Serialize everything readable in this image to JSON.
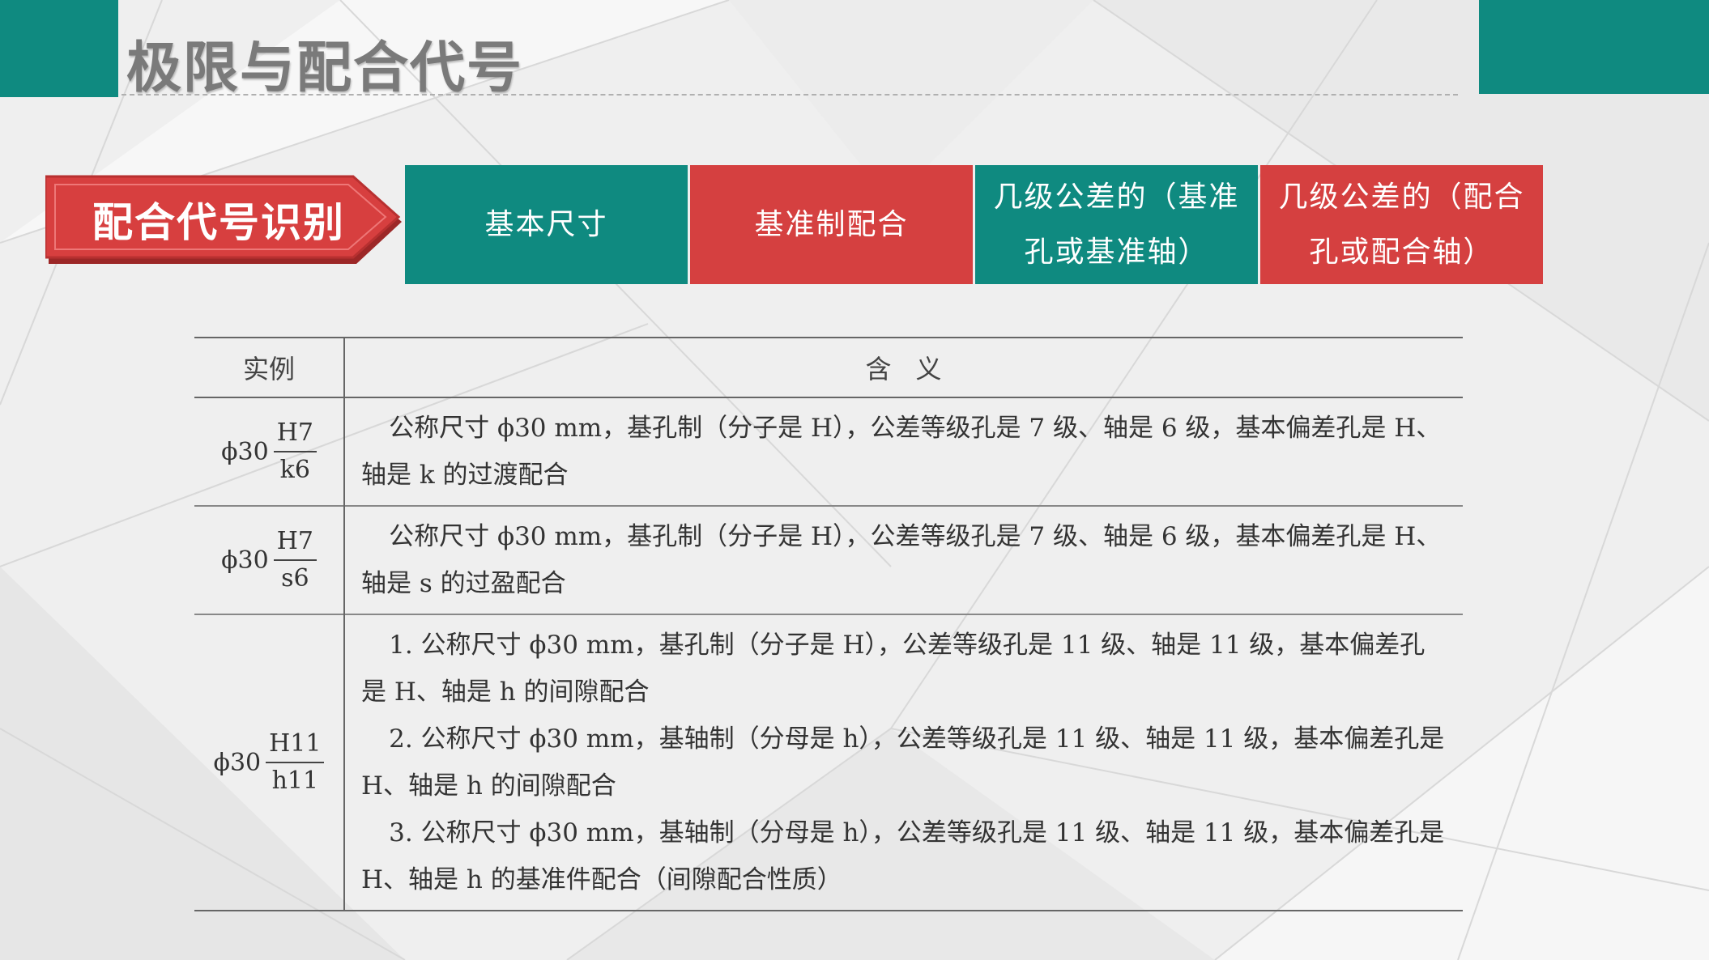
{
  "page_title": "极限与配合代号",
  "badge_label": "配合代号识别",
  "tabs": [
    {
      "label": "基本尺寸",
      "color": "#0f8a80"
    },
    {
      "label": "基准制配合",
      "color": "#d54040"
    },
    {
      "label": "几级公差的（基准\n孔或基准轴）",
      "color": "#0f8a80"
    },
    {
      "label": "几级公差的（配合\n孔或配合轴）",
      "color": "#d54040"
    }
  ],
  "table": {
    "headers": [
      "实例",
      "含义"
    ],
    "rows": [
      {
        "example": {
          "base": "ϕ30",
          "numerator": "H7",
          "denominator": "k6"
        },
        "paragraphs": [
          "公称尺寸 ϕ30 mm，基孔制（分子是 H），公差等级孔是 7 级、轴是 6 级，基本偏差孔是 H、轴是 k 的过渡配合"
        ]
      },
      {
        "example": {
          "base": "ϕ30",
          "numerator": "H7",
          "denominator": "s6"
        },
        "paragraphs": [
          "公称尺寸 ϕ30 mm，基孔制（分子是 H），公差等级孔是 7 级、轴是 6 级，基本偏差孔是 H、轴是 s 的过盈配合"
        ]
      },
      {
        "example": {
          "base": "ϕ30",
          "numerator": "H11",
          "denominator": "h11"
        },
        "paragraphs": [
          "1. 公称尺寸 ϕ30 mm，基孔制（分子是 H），公差等级孔是 11 级、轴是 11 级，基本偏差孔是 H、轴是 h 的间隙配合",
          "2. 公称尺寸 ϕ30 mm，基轴制（分母是 h），公差等级孔是 11 级、轴是 11 级，基本偏差孔是 H、轴是 h 的间隙配合",
          "3. 公称尺寸 ϕ30 mm，基轴制（分母是 h），公差等级孔是 11 级、轴是 11 级，基本偏差孔是 H、轴是 h 的基准件配合（间隙配合性质）"
        ]
      }
    ]
  },
  "colors": {
    "teal": "#0f8a80",
    "red": "#d54040",
    "title_gray": "#7a7a7a"
  }
}
